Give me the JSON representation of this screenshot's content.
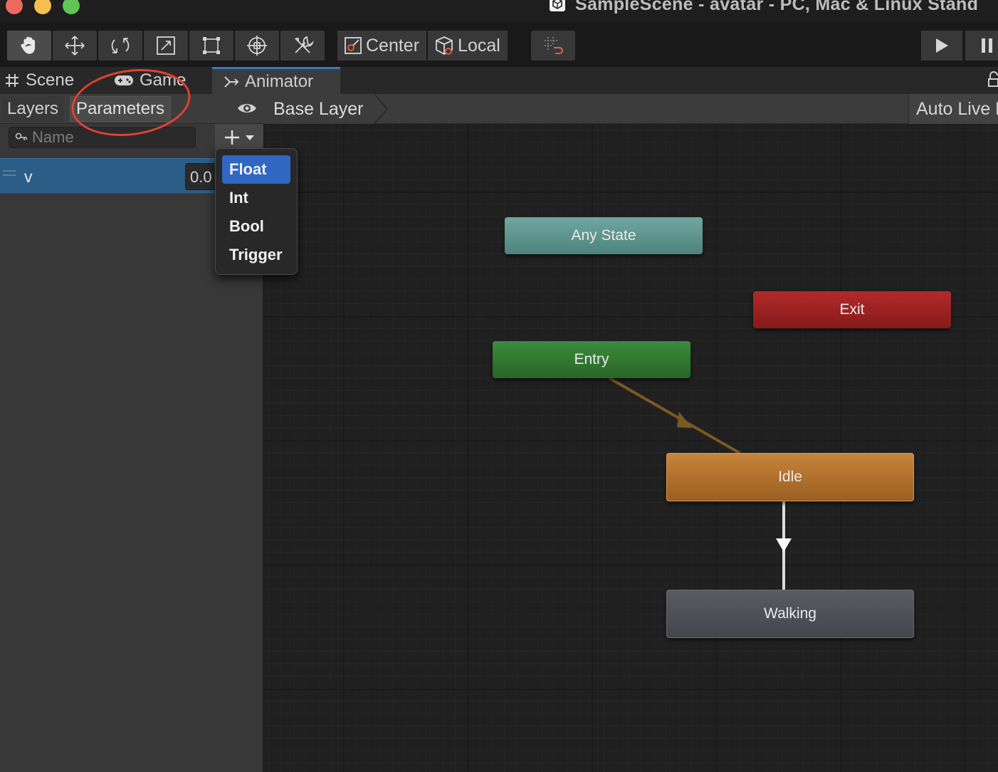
{
  "window": {
    "title": "SampleScene - avatar - PC, Mac & Linux Stand"
  },
  "toolbar": {
    "tools": [
      "hand-icon",
      "move-icon",
      "rotate-icon",
      "scale-icon",
      "rect-icon",
      "transform-icon",
      "custom-tool-icon"
    ],
    "pivot_label": "Center",
    "space_label": "Local"
  },
  "tabs": {
    "scene": "Scene",
    "game": "Game",
    "animator": "Animator"
  },
  "animator": {
    "layers_tab": "Layers",
    "parameters_tab": "Parameters",
    "breadcrumb": "Base Layer",
    "auto_live": "Auto Live L",
    "search_placeholder": "Name",
    "parameters": [
      {
        "name": "v",
        "value": "0.0"
      }
    ],
    "add_menu": [
      "Float",
      "Int",
      "Bool",
      "Trigger"
    ],
    "add_menu_selected": "Float",
    "states": {
      "any_state": "Any State",
      "exit": "Exit",
      "entry": "Entry",
      "idle": "Idle",
      "walking": "Walking"
    }
  },
  "colors": {
    "accent": "#2f67c3",
    "annotation": "#e0422f",
    "any_state": "#5f958f",
    "exit": "#9c2222",
    "entry": "#337833",
    "idle": "#b3722e",
    "walking": "#505156"
  }
}
